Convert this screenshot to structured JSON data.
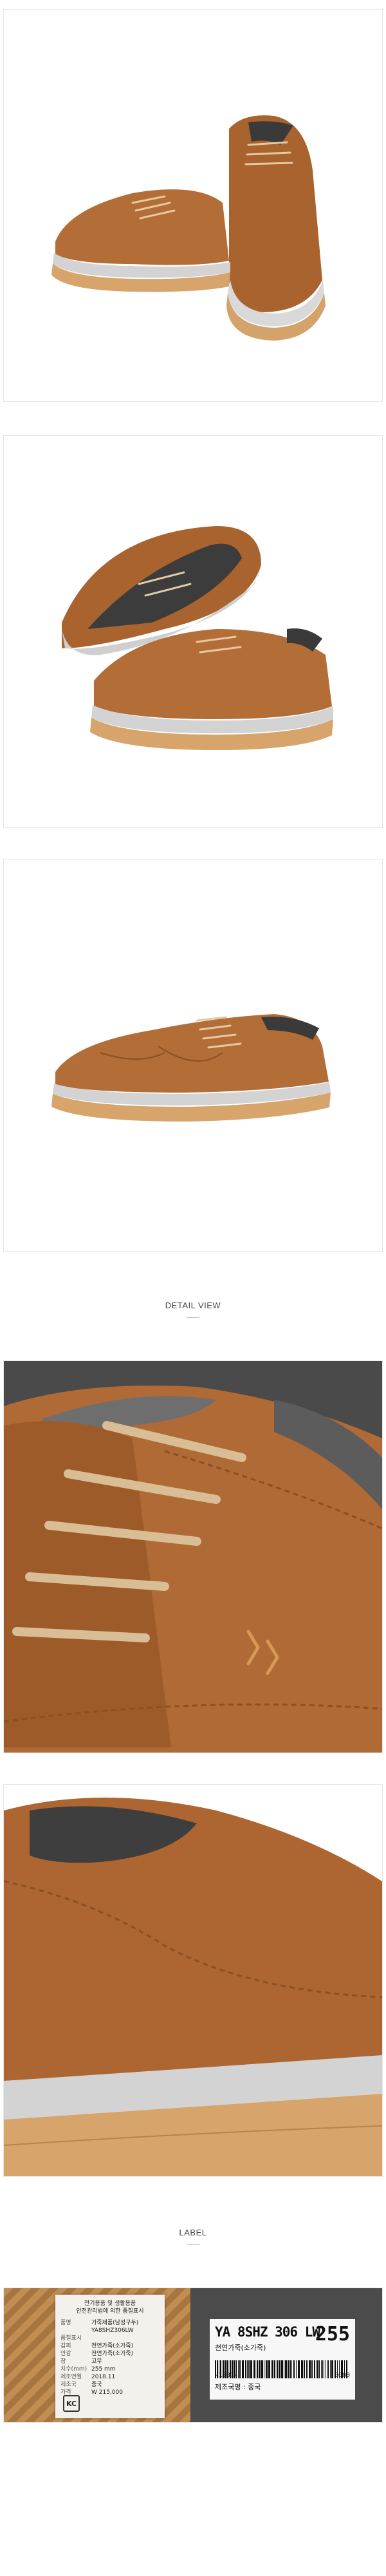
{
  "sections": {
    "detail_title": "DETAIL VIEW",
    "label_title": "LABEL"
  },
  "label_card": {
    "header_line1": "전기용품 및 생활용품",
    "header_line2": "안전관리법에 의한 품질표시",
    "rows": [
      {
        "k": "품명",
        "v": "가죽제품(남성구두)"
      },
      {
        "k": "",
        "v": "YA8SHZ306LW"
      },
      {
        "k": "품질표시",
        "v": ""
      },
      {
        "k": "갑피",
        "v": "천연가죽(소가죽)"
      },
      {
        "k": "안감",
        "v": "천연가죽(소가죽)"
      },
      {
        "k": "창",
        "v": "고무"
      },
      {
        "k": "치수(mm)",
        "v": "255 mm"
      },
      {
        "k": "제조연월",
        "v": "2018.11"
      },
      {
        "k": "제조국",
        "v": "중국"
      },
      {
        "k": "가격",
        "v": "W 215,000"
      }
    ],
    "kc_mark": "KC"
  },
  "sticker": {
    "model": "YA 8SHZ 306 LW",
    "size": "255",
    "kind": "천연가죽(소가죽)",
    "code_left": "-1801-",
    "code_right": "0000",
    "origin": "제조국명 : 중국"
  },
  "colors": {
    "leather": "#b06a35",
    "leather_dark": "#8a4f24",
    "sole_stripe": "#cfcfcf",
    "sole": "#d8a36b"
  }
}
